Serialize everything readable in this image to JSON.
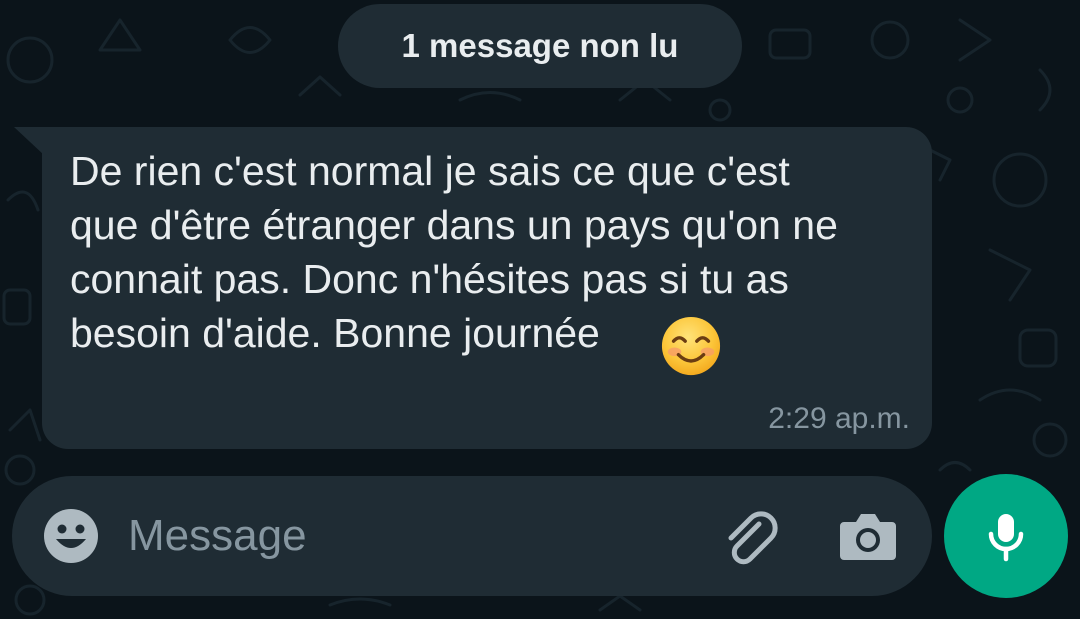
{
  "chat": {
    "unread_banner": "1 message non lu",
    "message": {
      "text": "De rien c'est normal je sais ce que c'est\nque d'être étranger dans un pays qu'on ne\nconnait pas. Donc n'hésites pas si tu as\nbesoin d'aide. Bonne journée",
      "emoji": "smiling-face-with-smiling-eyes",
      "time": "2:29 ap.m."
    }
  },
  "composer": {
    "placeholder": "Message",
    "icons": {
      "emoji": "emoji-icon",
      "attach": "paperclip-icon",
      "camera": "camera-icon",
      "send": "microphone-icon"
    }
  },
  "colors": {
    "background": "#0b141a",
    "bubble": "#1f2c34",
    "text": "#e9edef",
    "muted": "#8696a0",
    "accent": "#00a884"
  }
}
